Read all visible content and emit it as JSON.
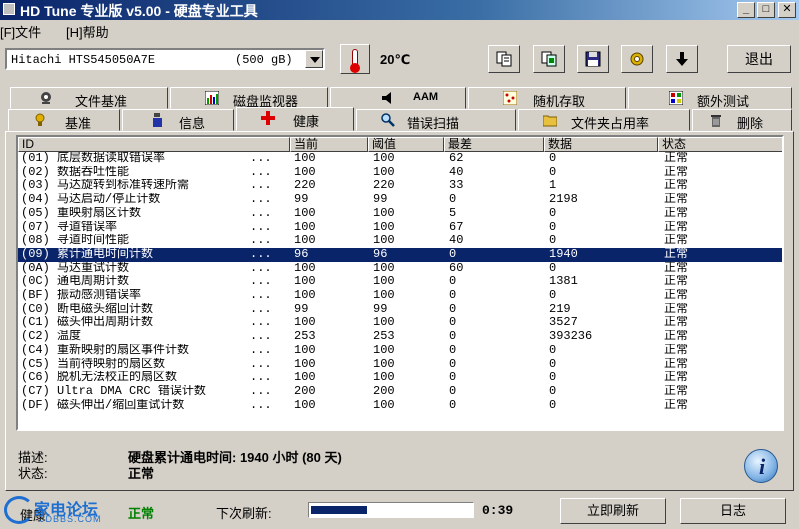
{
  "window": {
    "title": "HD Tune 专业版 v5.00 - 硬盘专业工具",
    "min": "_",
    "max": "□",
    "close": "✕"
  },
  "menu": {
    "file": "[F]文件",
    "help": "[H]帮助"
  },
  "toolbar": {
    "drive_name": "Hitachi HTS545050A7E",
    "drive_size": "(500 gB)",
    "temperature": "20℃",
    "exit_label": "退出",
    "icons": [
      "copy-text-icon",
      "copy-screen-icon",
      "save-icon",
      "options-icon",
      "down-arrow-icon"
    ]
  },
  "tabs_top": [
    {
      "label": "文件基准",
      "icon": "file-benchmark-icon"
    },
    {
      "label": "磁盘监视器",
      "icon": "disk-monitor-icon"
    },
    {
      "label": "AAM",
      "icon": "aam-icon"
    },
    {
      "label": "随机存取",
      "icon": "random-access-icon"
    },
    {
      "label": "额外测试",
      "icon": "extra-tests-icon"
    }
  ],
  "tabs_bottom": [
    {
      "label": "基准",
      "icon": "benchmark-icon"
    },
    {
      "label": "信息",
      "icon": "info-icon"
    },
    {
      "label": "健康",
      "icon": "health-cross-icon"
    },
    {
      "label": "错误扫描",
      "icon": "error-scan-icon"
    },
    {
      "label": "文件夹占用率",
      "icon": "folder-icon"
    },
    {
      "label": "删除",
      "icon": "erase-icon"
    }
  ],
  "table": {
    "headers": [
      "ID",
      "当前",
      "阈值",
      "最差",
      "数据",
      "状态"
    ],
    "dots": "...",
    "selected_index": 7,
    "rows": [
      {
        "id": "(01) 底层数据读取错误率",
        "cur": "100",
        "thr": "100",
        "worst": "62",
        "data": "0",
        "status": "正常"
      },
      {
        "id": "(02) 数据吞吐性能",
        "cur": "100",
        "thr": "100",
        "worst": "40",
        "data": "0",
        "status": "正常"
      },
      {
        "id": "(03) 马达旋转到标准转速所需",
        "cur": "220",
        "thr": "220",
        "worst": "33",
        "data": "1",
        "status": "正常"
      },
      {
        "id": "(04) 马达启动/停止计数",
        "cur": "99",
        "thr": "99",
        "worst": "0",
        "data": "2198",
        "status": "正常"
      },
      {
        "id": "(05) 重映射扇区计数",
        "cur": "100",
        "thr": "100",
        "worst": "5",
        "data": "0",
        "status": "正常"
      },
      {
        "id": "(07) 寻道错误率",
        "cur": "100",
        "thr": "100",
        "worst": "67",
        "data": "0",
        "status": "正常"
      },
      {
        "id": "(08) 寻道时间性能",
        "cur": "100",
        "thr": "100",
        "worst": "40",
        "data": "0",
        "status": "正常"
      },
      {
        "id": "(09) 累计通电时间计数",
        "cur": "96",
        "thr": "96",
        "worst": "0",
        "data": "1940",
        "status": "正常"
      },
      {
        "id": "(0A) 马达重试计数",
        "cur": "100",
        "thr": "100",
        "worst": "60",
        "data": "0",
        "status": "正常"
      },
      {
        "id": "(0C) 通电周期计数",
        "cur": "100",
        "thr": "100",
        "worst": "0",
        "data": "1381",
        "status": "正常"
      },
      {
        "id": "(BF) 振动感测错误率",
        "cur": "100",
        "thr": "100",
        "worst": "0",
        "data": "0",
        "status": "正常"
      },
      {
        "id": "(C0) 断电磁头缩回计数",
        "cur": "99",
        "thr": "99",
        "worst": "0",
        "data": "219",
        "status": "正常"
      },
      {
        "id": "(C1) 磁头伸出周期计数",
        "cur": "100",
        "thr": "100",
        "worst": "0",
        "data": "3527",
        "status": "正常"
      },
      {
        "id": "(C2) 温度",
        "cur": "253",
        "thr": "253",
        "worst": "0",
        "data": "393236",
        "status": "正常"
      },
      {
        "id": "(C4) 重新映射的扇区事件计数",
        "cur": "100",
        "thr": "100",
        "worst": "0",
        "data": "0",
        "status": "正常"
      },
      {
        "id": "(C5) 当前待映射的扇区数",
        "cur": "100",
        "thr": "100",
        "worst": "0",
        "data": "0",
        "status": "正常"
      },
      {
        "id": "(C6) 脱机无法校正的扇区数",
        "cur": "100",
        "thr": "100",
        "worst": "0",
        "data": "0",
        "status": "正常"
      },
      {
        "id": "(C7) Ultra DMA CRC 错误计数",
        "cur": "200",
        "thr": "200",
        "worst": "0",
        "data": "0",
        "status": "正常"
      },
      {
        "id": "(DF) 磁头伸出/缩回重试计数",
        "cur": "100",
        "thr": "100",
        "worst": "0",
        "data": "0",
        "status": "正常"
      }
    ]
  },
  "info": {
    "desc_label": "描述:",
    "desc_value": "硬盘累计通电时间: 1940 小时 (80 天)",
    "status_label": "状态:",
    "status_value": "正常"
  },
  "status_bar": {
    "health_label": "健康",
    "health_value": "正常",
    "refresh_label": "下次刷新:",
    "progress_fraction": 0.35,
    "time_left": "0:39",
    "refresh_now": "立即刷新",
    "log": "日志"
  },
  "watermark": {
    "text": "家电论坛",
    "sub": "JDBBS.COM"
  },
  "colors": {
    "selection": "#0a246a",
    "health_ok": "#008000",
    "titlebar": "#0a246a"
  }
}
